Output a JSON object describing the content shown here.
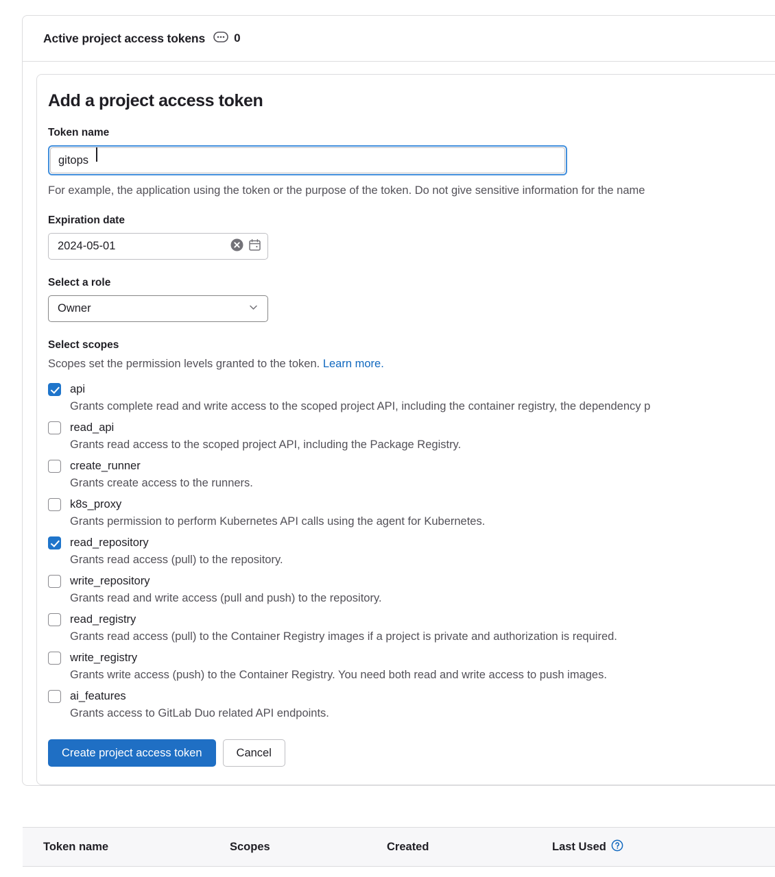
{
  "header": {
    "title": "Active project access tokens",
    "badge_icon": "comment-dots-icon",
    "count": "0"
  },
  "form": {
    "title": "Add a project access token",
    "token_name": {
      "label": "Token name",
      "value": "gitops",
      "placeholder": "",
      "help": "For example, the application using the token or the purpose of the token. Do not give sensitive information for the name"
    },
    "expiration": {
      "label": "Expiration date",
      "value": "2024-05-01",
      "clear_icon": "clear-circle-icon",
      "calendar_icon": "calendar-icon"
    },
    "role": {
      "label": "Select a role",
      "value": "Owner",
      "chevron_icon": "chevron-down-icon"
    },
    "scopes": {
      "label": "Select scopes",
      "description": "Scopes set the permission levels granted to the token.",
      "link_text": "Learn more.",
      "items": [
        {
          "name": "api",
          "checked": true,
          "description": "Grants complete read and write access to the scoped project API, including the container registry, the dependency p"
        },
        {
          "name": "read_api",
          "checked": false,
          "description": "Grants read access to the scoped project API, including the Package Registry."
        },
        {
          "name": "create_runner",
          "checked": false,
          "description": "Grants create access to the runners."
        },
        {
          "name": "k8s_proxy",
          "checked": false,
          "description": "Grants permission to perform Kubernetes API calls using the agent for Kubernetes."
        },
        {
          "name": "read_repository",
          "checked": true,
          "description": "Grants read access (pull) to the repository."
        },
        {
          "name": "write_repository",
          "checked": false,
          "description": "Grants read and write access (pull and push) to the repository."
        },
        {
          "name": "read_registry",
          "checked": false,
          "description": "Grants read access (pull) to the Container Registry images if a project is private and authorization is required."
        },
        {
          "name": "write_registry",
          "checked": false,
          "description": "Grants write access (push) to the Container Registry. You need both read and write access to push images."
        },
        {
          "name": "ai_features",
          "checked": false,
          "description": "Grants access to GitLab Duo related API endpoints."
        }
      ]
    },
    "submit_label": "Create project access token",
    "cancel_label": "Cancel"
  },
  "table": {
    "columns": [
      "Token name",
      "Scopes",
      "Created",
      "Last Used"
    ],
    "last_used_help_icon": "question-circle-icon"
  },
  "colors": {
    "primary": "#1f6fc4",
    "checkbox_checked": "#1f75cb",
    "link": "#1068bf",
    "focus_ring": "#428fdc",
    "muted_text": "#535158",
    "border": "#dcdcde"
  }
}
